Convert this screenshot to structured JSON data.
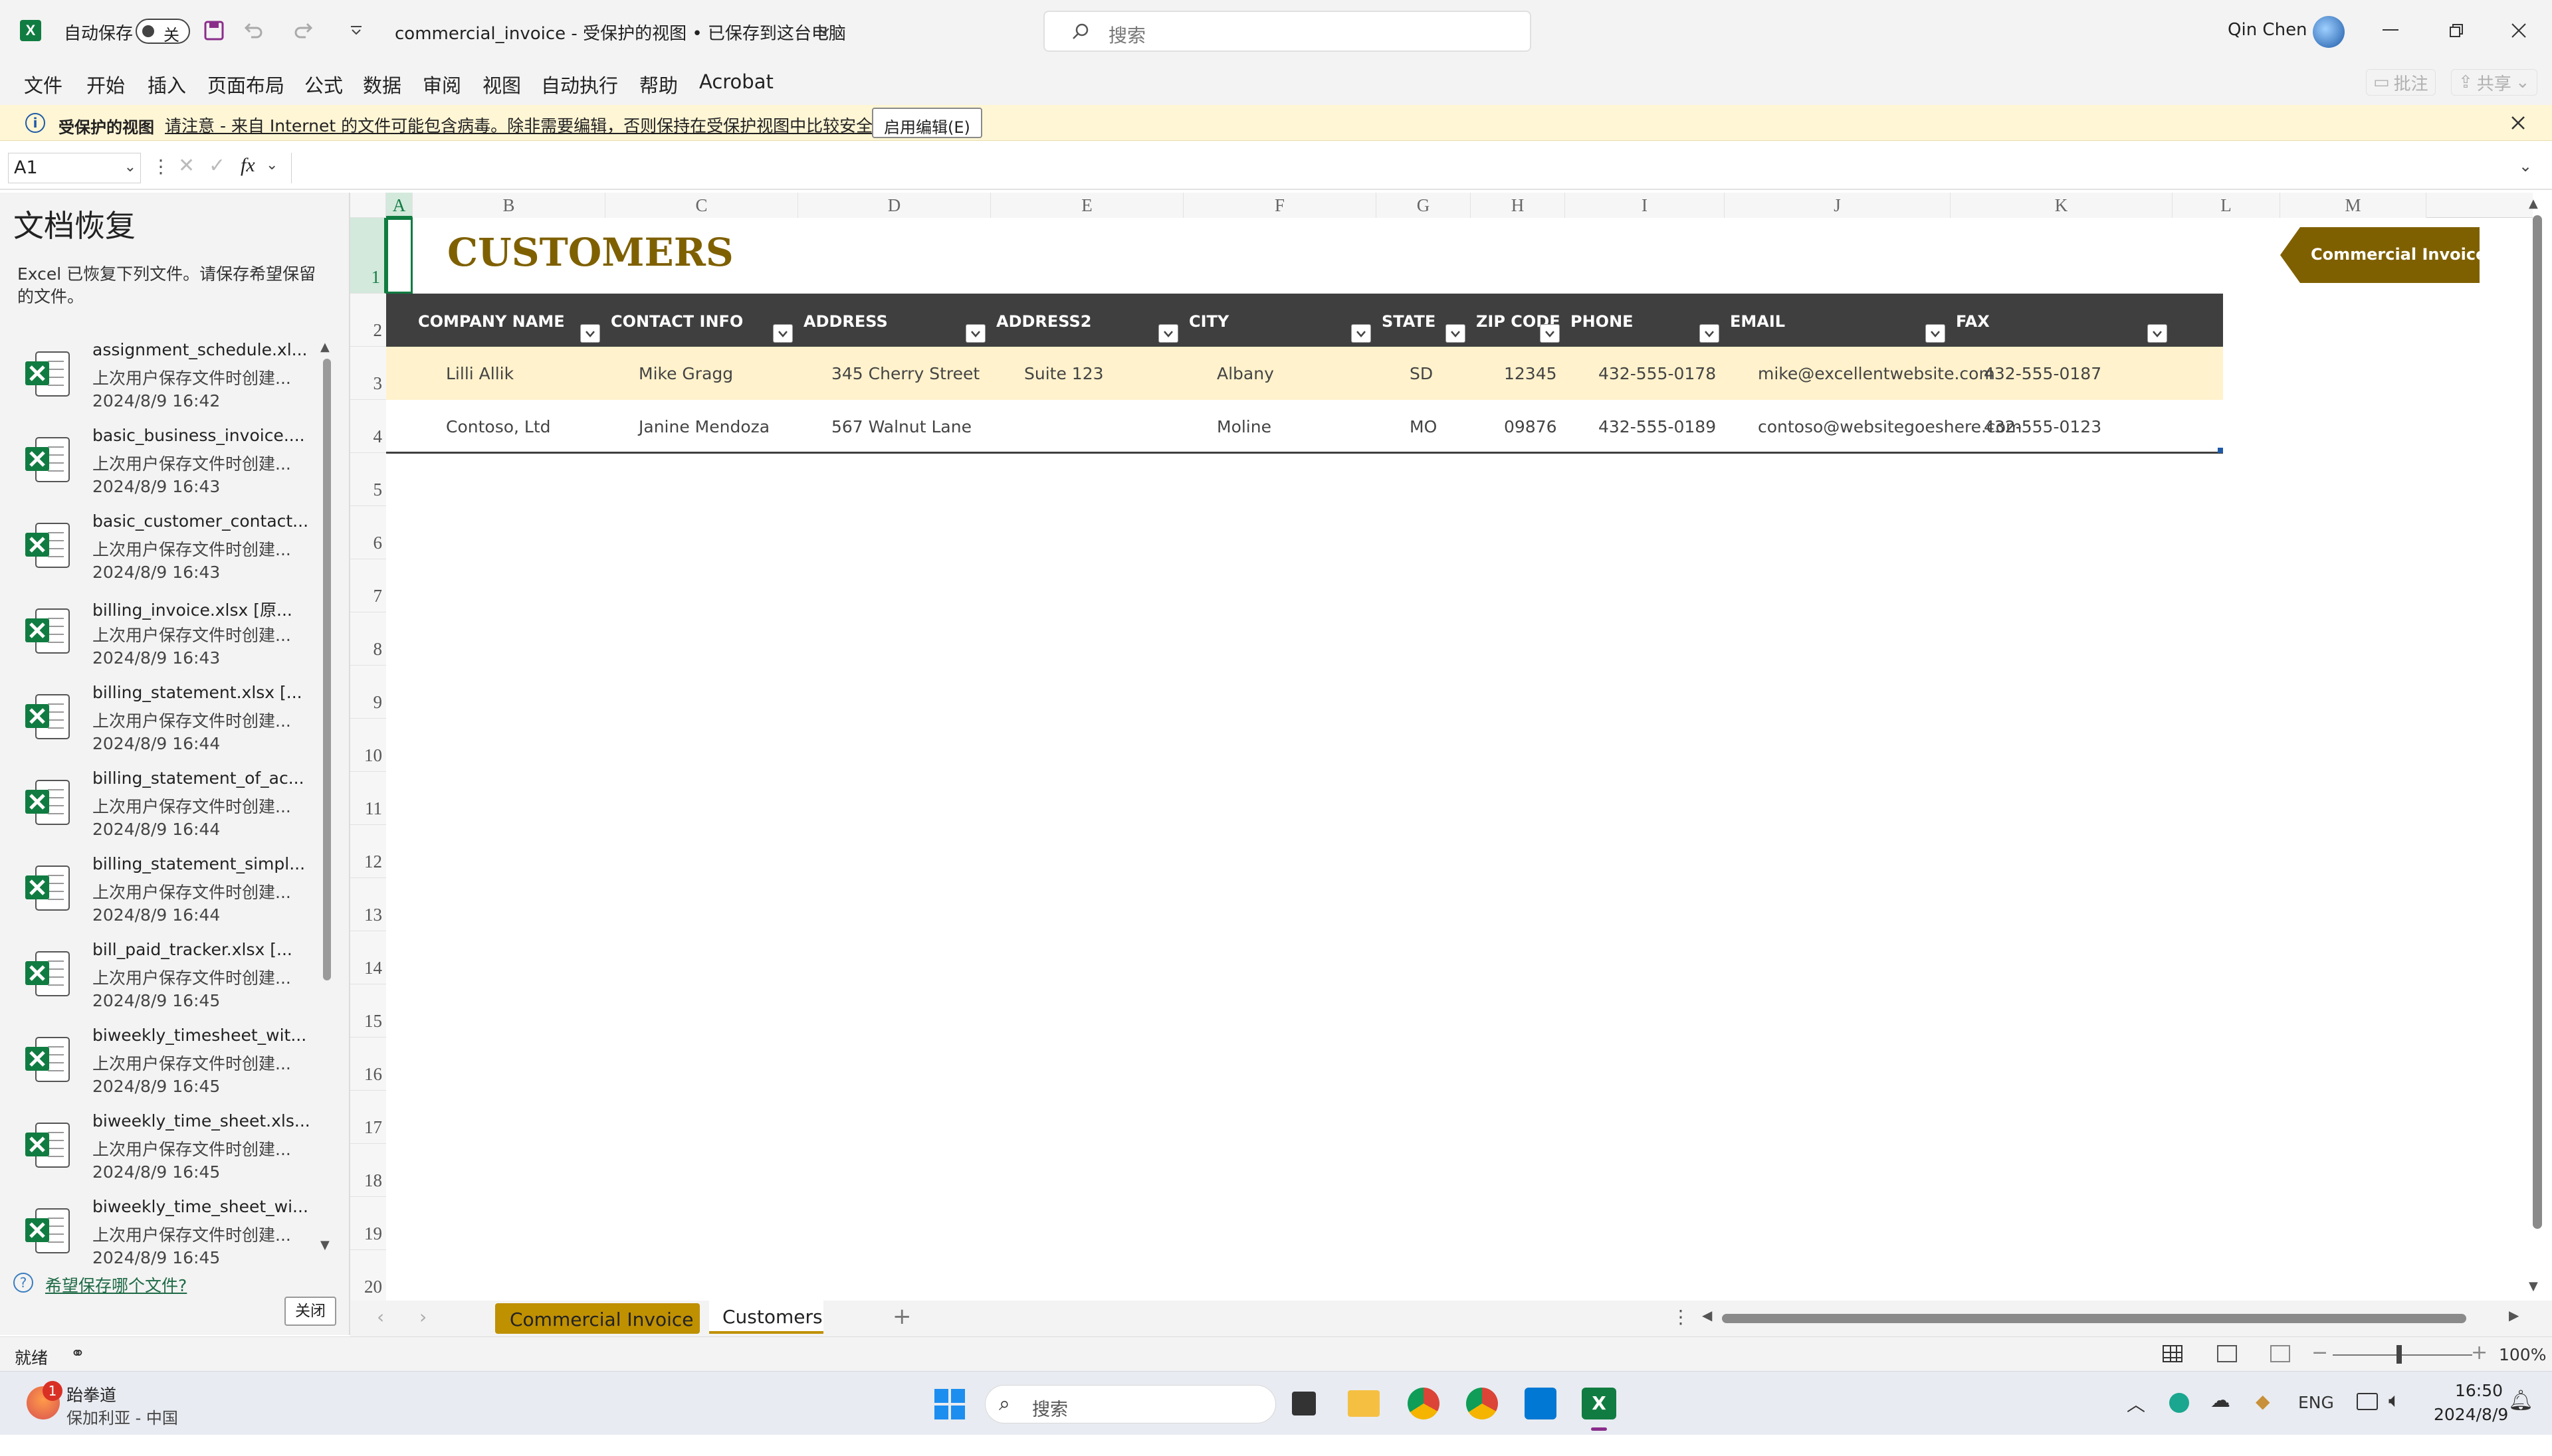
{
  "app": {
    "autosave_label": "自动保存",
    "autosave_state": "关",
    "doc_title": "commercial_invoice  -  受保护的视图 • 已保存到这台电脑",
    "search_placeholder": "搜索",
    "user_name": "Qin Chen"
  },
  "menu": {
    "items": [
      "文件",
      "开始",
      "插入",
      "页面布局",
      "公式",
      "数据",
      "审阅",
      "视图",
      "自动执行",
      "帮助",
      "Acrobat"
    ],
    "comments": "批注",
    "share": "共享"
  },
  "protected_view": {
    "title": "受保护的视图",
    "message": "请注意 - 来自 Internet 的文件可能包含病毒。除非需要编辑，否则保持在受保护视图中比较安全。",
    "enable_button": "启用编辑(E)"
  },
  "formula_bar": {
    "name_box": "A1",
    "fx": "fx",
    "formula": ""
  },
  "recovery": {
    "title": "文档恢复",
    "description": "Excel 已恢复下列文件。请保存希望保留的文件。",
    "items": [
      {
        "name": "assignment_schedule.xl...",
        "sub": "上次用户保存文件时创建...",
        "date": "2024/8/9 16:42"
      },
      {
        "name": "basic_business_invoice....",
        "sub": "上次用户保存文件时创建...",
        "date": "2024/8/9 16:43"
      },
      {
        "name": "basic_customer_contact...",
        "sub": "上次用户保存文件时创建...",
        "date": "2024/8/9 16:43"
      },
      {
        "name": "billing_invoice.xlsx  [原...",
        "sub": "上次用户保存文件时创建...",
        "date": "2024/8/9 16:43"
      },
      {
        "name": "billing_statement.xlsx  [...",
        "sub": "上次用户保存文件时创建...",
        "date": "2024/8/9 16:44"
      },
      {
        "name": "billing_statement_of_ac...",
        "sub": "上次用户保存文件时创建...",
        "date": "2024/8/9 16:44"
      },
      {
        "name": "billing_statement_simpl...",
        "sub": "上次用户保存文件时创建...",
        "date": "2024/8/9 16:44"
      },
      {
        "name": "bill_paid_tracker.xlsx  [...",
        "sub": "上次用户保存文件时创建...",
        "date": "2024/8/9 16:45"
      },
      {
        "name": "biweekly_timesheet_wit...",
        "sub": "上次用户保存文件时创建...",
        "date": "2024/8/9 16:45"
      },
      {
        "name": "biweekly_time_sheet.xls...",
        "sub": "上次用户保存文件时创建...",
        "date": "2024/8/9 16:45"
      },
      {
        "name": "biweekly_time_sheet_wi...",
        "sub": "上次用户保存文件时创建...",
        "date": "2024/8/9 16:45"
      }
    ],
    "help_link": "希望保存哪个文件?",
    "close_button": "关闭"
  },
  "sheet": {
    "columns": [
      "A",
      "B",
      "C",
      "D",
      "E",
      "F",
      "G",
      "H",
      "I",
      "J",
      "K",
      "L",
      "M"
    ],
    "rows": [
      "1",
      "2",
      "3",
      "4",
      "5",
      "6",
      "7",
      "8",
      "9",
      "10",
      "11",
      "12",
      "13",
      "14",
      "15",
      "16",
      "17",
      "18",
      "19",
      "20"
    ],
    "title": "CUSTOMERS",
    "nav_button": "Commercial Invoice",
    "table": {
      "headers": [
        "COMPANY NAME",
        "CONTACT INFO",
        "ADDRESS",
        "ADDRESS2",
        "CITY",
        "STATE",
        "ZIP CODE",
        "PHONE",
        "EMAIL",
        "FAX"
      ],
      "rows": [
        [
          "Lilli Allik",
          "Mike Gragg",
          "345 Cherry Street",
          "Suite 123",
          "Albany",
          "SD",
          "12345",
          "432-555-0178",
          "mike@excellentwebsite.com",
          "432-555-0187"
        ],
        [
          "Contoso, Ltd",
          "Janine Mendoza",
          "567 Walnut Lane",
          "",
          "Moline",
          "MO",
          "09876",
          "432-555-0189",
          "contoso@websitegoeshere.com",
          "432-555-0123"
        ]
      ]
    },
    "accent_color": "#7f6000",
    "header_bg": "#3f3f3f",
    "band_color": "#fff2cc"
  },
  "tabs": {
    "items": [
      "Commercial Invoice",
      "Customers"
    ],
    "active": "Customers"
  },
  "status": {
    "ready": "就绪",
    "zoom": "100%"
  },
  "taskbar": {
    "weather_title": "跆拳道",
    "weather_sub": "保加利亚 - 中国",
    "weather_badge": "1",
    "search": "搜索",
    "lang": "ENG",
    "time": "16:50",
    "date": "2024/8/9"
  }
}
